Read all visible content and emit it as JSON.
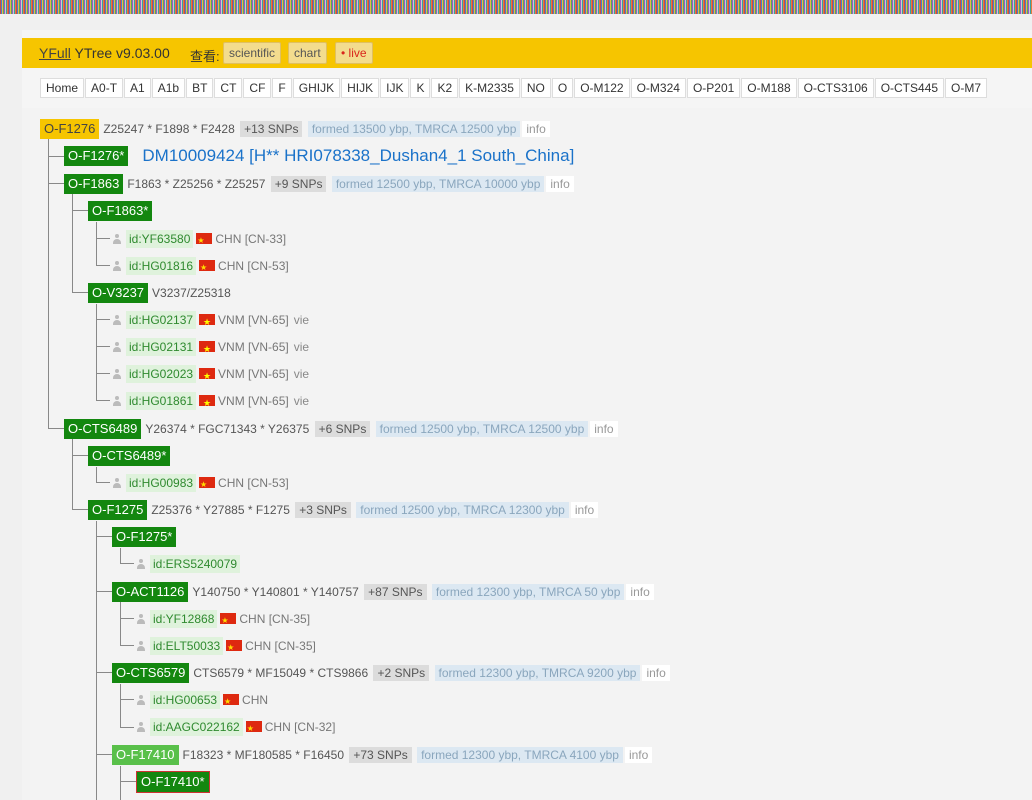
{
  "header": {
    "brand_link": "YFull",
    "brand_rest": " YTree v9.03.00",
    "view_label": "查看:",
    "view_buttons": [
      "scientific",
      "chart",
      "• live"
    ]
  },
  "tabs": [
    "Home",
    "A0-T",
    "A1",
    "A1b",
    "BT",
    "CT",
    "CF",
    "F",
    "GHIJK",
    "HIJK",
    "IJK",
    "K",
    "K2",
    "K-M2335",
    "NO",
    "O",
    "O-M122",
    "O-M324",
    "O-P201",
    "O-M188",
    "O-CTS3106",
    "O-CTS445",
    "O-M7"
  ],
  "tree": {
    "root": {
      "name": "O-F1276",
      "snps": "Z25247 * F1898 * F2428",
      "more": "+13 SNPs",
      "formed": "formed 13500 ybp, TMRCA 12500 ybp",
      "info": "info"
    },
    "sample_node": {
      "name": "O-F1276*",
      "title": "DM10009424 [H** HRI078338_Dushan4_1 South_China]"
    },
    "f1863": {
      "name": "O-F1863",
      "snps": "F1863 * Z25256 * Z25257",
      "more": "+9 SNPs",
      "formed": "formed 12500 ybp, TMRCA 10000 ybp",
      "info": "info"
    },
    "f1863s": {
      "name": "O-F1863*"
    },
    "s_yf63580": {
      "id": "id:YF63580",
      "country": "CHN [CN-33]"
    },
    "s_hg01816": {
      "id": "id:HG01816",
      "country": "CHN [CN-53]"
    },
    "v3237": {
      "name": "O-V3237",
      "snps": "V3237/Z25318"
    },
    "s_hg02137": {
      "id": "id:HG02137",
      "country": "VNM [VN-65]",
      "lang": "vie"
    },
    "s_hg02131": {
      "id": "id:HG02131",
      "country": "VNM [VN-65]",
      "lang": "vie"
    },
    "s_hg02023": {
      "id": "id:HG02023",
      "country": "VNM [VN-65]",
      "lang": "vie"
    },
    "s_hg01861": {
      "id": "id:HG01861",
      "country": "VNM [VN-65]",
      "lang": "vie"
    },
    "cts6489": {
      "name": "O-CTS6489",
      "snps": "Y26374 * FGC71343 * Y26375",
      "more": "+6 SNPs",
      "formed": "formed 12500 ybp, TMRCA 12500 ybp",
      "info": "info"
    },
    "cts6489s": {
      "name": "O-CTS6489*"
    },
    "s_hg00983": {
      "id": "id:HG00983",
      "country": "CHN [CN-53]"
    },
    "f1275": {
      "name": "O-F1275",
      "snps": "Z25376 * Y27885 * F1275",
      "more": "+3 SNPs",
      "formed": "formed 12500 ybp, TMRCA 12300 ybp",
      "info": "info"
    },
    "f1275s": {
      "name": "O-F1275*"
    },
    "s_ers5240079": {
      "id": "id:ERS5240079"
    },
    "act1126": {
      "name": "O-ACT1126",
      "snps": "Y140750 * Y140801 * Y140757",
      "more": "+87 SNPs",
      "formed": "formed 12300 ybp, TMRCA 50 ybp",
      "info": "info"
    },
    "s_yf12868": {
      "id": "id:YF12868",
      "country": "CHN [CN-35]"
    },
    "s_elt50033": {
      "id": "id:ELT50033",
      "country": "CHN [CN-35]"
    },
    "cts6579": {
      "name": "O-CTS6579",
      "snps": "CTS6579 * MF15049 * CTS9866",
      "more": "+2 SNPs",
      "formed": "formed 12300 ybp, TMRCA 9200 ybp",
      "info": "info"
    },
    "s_hg00653": {
      "id": "id:HG00653",
      "country": "CHN"
    },
    "s_aagc022162": {
      "id": "id:AAGC022162",
      "country": "CHN [CN-32]"
    },
    "f17410": {
      "name": "O-F17410",
      "snps": "F18323 * MF180585 * F16450",
      "more": "+73 SNPs",
      "formed": "formed 12300 ybp, TMRCA 4100 ybp",
      "info": "info"
    },
    "f17410s": {
      "name": "O-F17410*"
    }
  }
}
